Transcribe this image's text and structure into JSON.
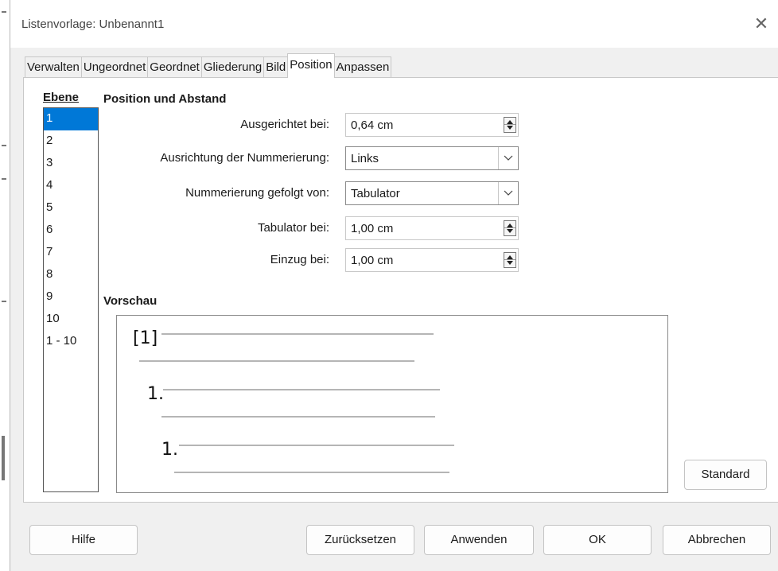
{
  "dialog": {
    "title": "Listenvorlage: Unbenannt1",
    "close_glyph": "✕"
  },
  "tabs": [
    {
      "label": "Verwalten",
      "active": false
    },
    {
      "label": "Ungeordnet",
      "active": false
    },
    {
      "label": "Geordnet",
      "active": false
    },
    {
      "label": "Gliederung",
      "active": false
    },
    {
      "label": "Bild",
      "active": false
    },
    {
      "label": "Position",
      "active": true
    },
    {
      "label": "Anpassen",
      "active": false
    }
  ],
  "levels": {
    "title": "Ebene",
    "items": [
      "1",
      "2",
      "3",
      "4",
      "5",
      "6",
      "7",
      "8",
      "9",
      "10",
      "1 - 10"
    ],
    "selected": "1"
  },
  "position": {
    "section_title": "Position und Abstand",
    "aligned_at": {
      "label": "Ausgerichtet bei:",
      "value": "0,64 cm"
    },
    "numbering_alignment": {
      "label": "Ausrichtung der Nummerierung:",
      "value": "Links"
    },
    "numbering_followed_by": {
      "label": "Nummerierung gefolgt von:",
      "value": "Tabulator"
    },
    "tab_at": {
      "label": "Tabulator bei:",
      "value": "1,00 cm"
    },
    "indent_at": {
      "label": "Einzug bei:",
      "value": "1,00 cm"
    }
  },
  "preview": {
    "title": "Vorschau",
    "numbers": [
      "[1]",
      "1.",
      "1."
    ]
  },
  "buttons": {
    "standard": "Standard",
    "help": "Hilfe",
    "reset": "Zurücksetzen",
    "apply": "Anwenden",
    "ok": "OK",
    "cancel": "Abbrechen"
  },
  "colors": {
    "selection": "#0078d7",
    "dialog_bg": "#f0f0f0"
  }
}
